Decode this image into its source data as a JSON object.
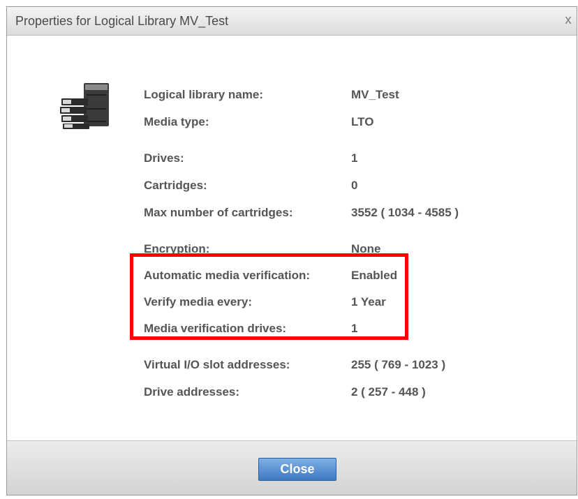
{
  "dialog": {
    "title": "Properties for Logical Library MV_Test",
    "close_glyph": "x"
  },
  "icon": {
    "name": "tape-library-icon"
  },
  "properties": [
    {
      "label": "Logical library name:",
      "value": "MV_Test"
    },
    {
      "label": "Media type:",
      "value": "LTO"
    },
    {
      "label": "Drives:",
      "value": "1"
    },
    {
      "label": "Cartridges:",
      "value": "0"
    },
    {
      "label": "Max number of cartridges:",
      "value": "3552 ( 1034 - 4585 )"
    },
    {
      "label": "Encryption:",
      "value": "None"
    },
    {
      "label": "Automatic media verification:",
      "value": "Enabled"
    },
    {
      "label": "Verify media every:",
      "value": "1 Year"
    },
    {
      "label": "Media verification drives:",
      "value": "1"
    },
    {
      "label": "Virtual I/O slot addresses:",
      "value": "255 ( 769 - 1023 )"
    },
    {
      "label": "Drive addresses:",
      "value": "2 ( 257 - 448 )"
    }
  ],
  "footer": {
    "close_label": "Close"
  },
  "colors": {
    "highlight": "#ff0000",
    "button": "#3e78c2",
    "text": "#555555"
  }
}
